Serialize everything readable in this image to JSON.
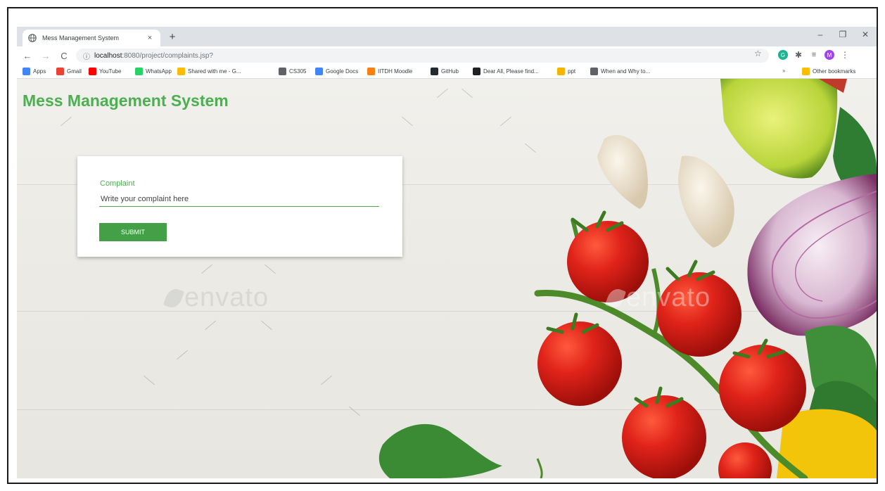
{
  "browser": {
    "tab_title": "Mess Management System",
    "tab_close": "×",
    "new_tab": "+",
    "window_controls": {
      "minimize": "–",
      "maximize": "❐",
      "close": "✕"
    },
    "nav": {
      "back": "←",
      "forward": "→",
      "reload": "C"
    },
    "url_host": "localhost",
    "url_path": ":8080/project/complaints.jsp?",
    "profile_initial": "M",
    "bookmarks": [
      {
        "label": "Apps",
        "icon": "apps-grid-icon",
        "color": "#4285f4"
      },
      {
        "label": "Gmail",
        "icon": "gmail-icon",
        "color": "#ea4335"
      },
      {
        "label": "YouTube",
        "icon": "youtube-icon",
        "color": "#ff0000"
      },
      {
        "label": "WhatsApp",
        "icon": "whatsapp-icon",
        "color": "#25d366"
      },
      {
        "label": "Shared with me - G...",
        "icon": "google-drive-icon",
        "color": "#fbbc04"
      },
      {
        "label": "CS305",
        "icon": "globe-icon",
        "color": "#5f6368"
      },
      {
        "label": "Google Docs",
        "icon": "google-docs-icon",
        "color": "#4285f4"
      },
      {
        "label": "IITDH Moodle",
        "icon": "moodle-icon",
        "color": "#f98012"
      },
      {
        "label": "GitHub",
        "icon": "github-icon",
        "color": "#24292e"
      },
      {
        "label": "Dear All, Please find...",
        "icon": "document-icon",
        "color": "#202124"
      },
      {
        "label": "ppt",
        "icon": "slides-icon",
        "color": "#f4b400"
      },
      {
        "label": "When and Why to...",
        "icon": "person-icon",
        "color": "#5f6368"
      }
    ],
    "overflow": "»",
    "other_bookmarks": "Other bookmarks"
  },
  "page": {
    "site_title": "Mess Management System",
    "form": {
      "label": "Complaint",
      "placeholder": "Write your complaint here",
      "value": "",
      "submit_label": "SUBMIT"
    },
    "watermark": "envato",
    "accent_color": "#4caf50"
  }
}
